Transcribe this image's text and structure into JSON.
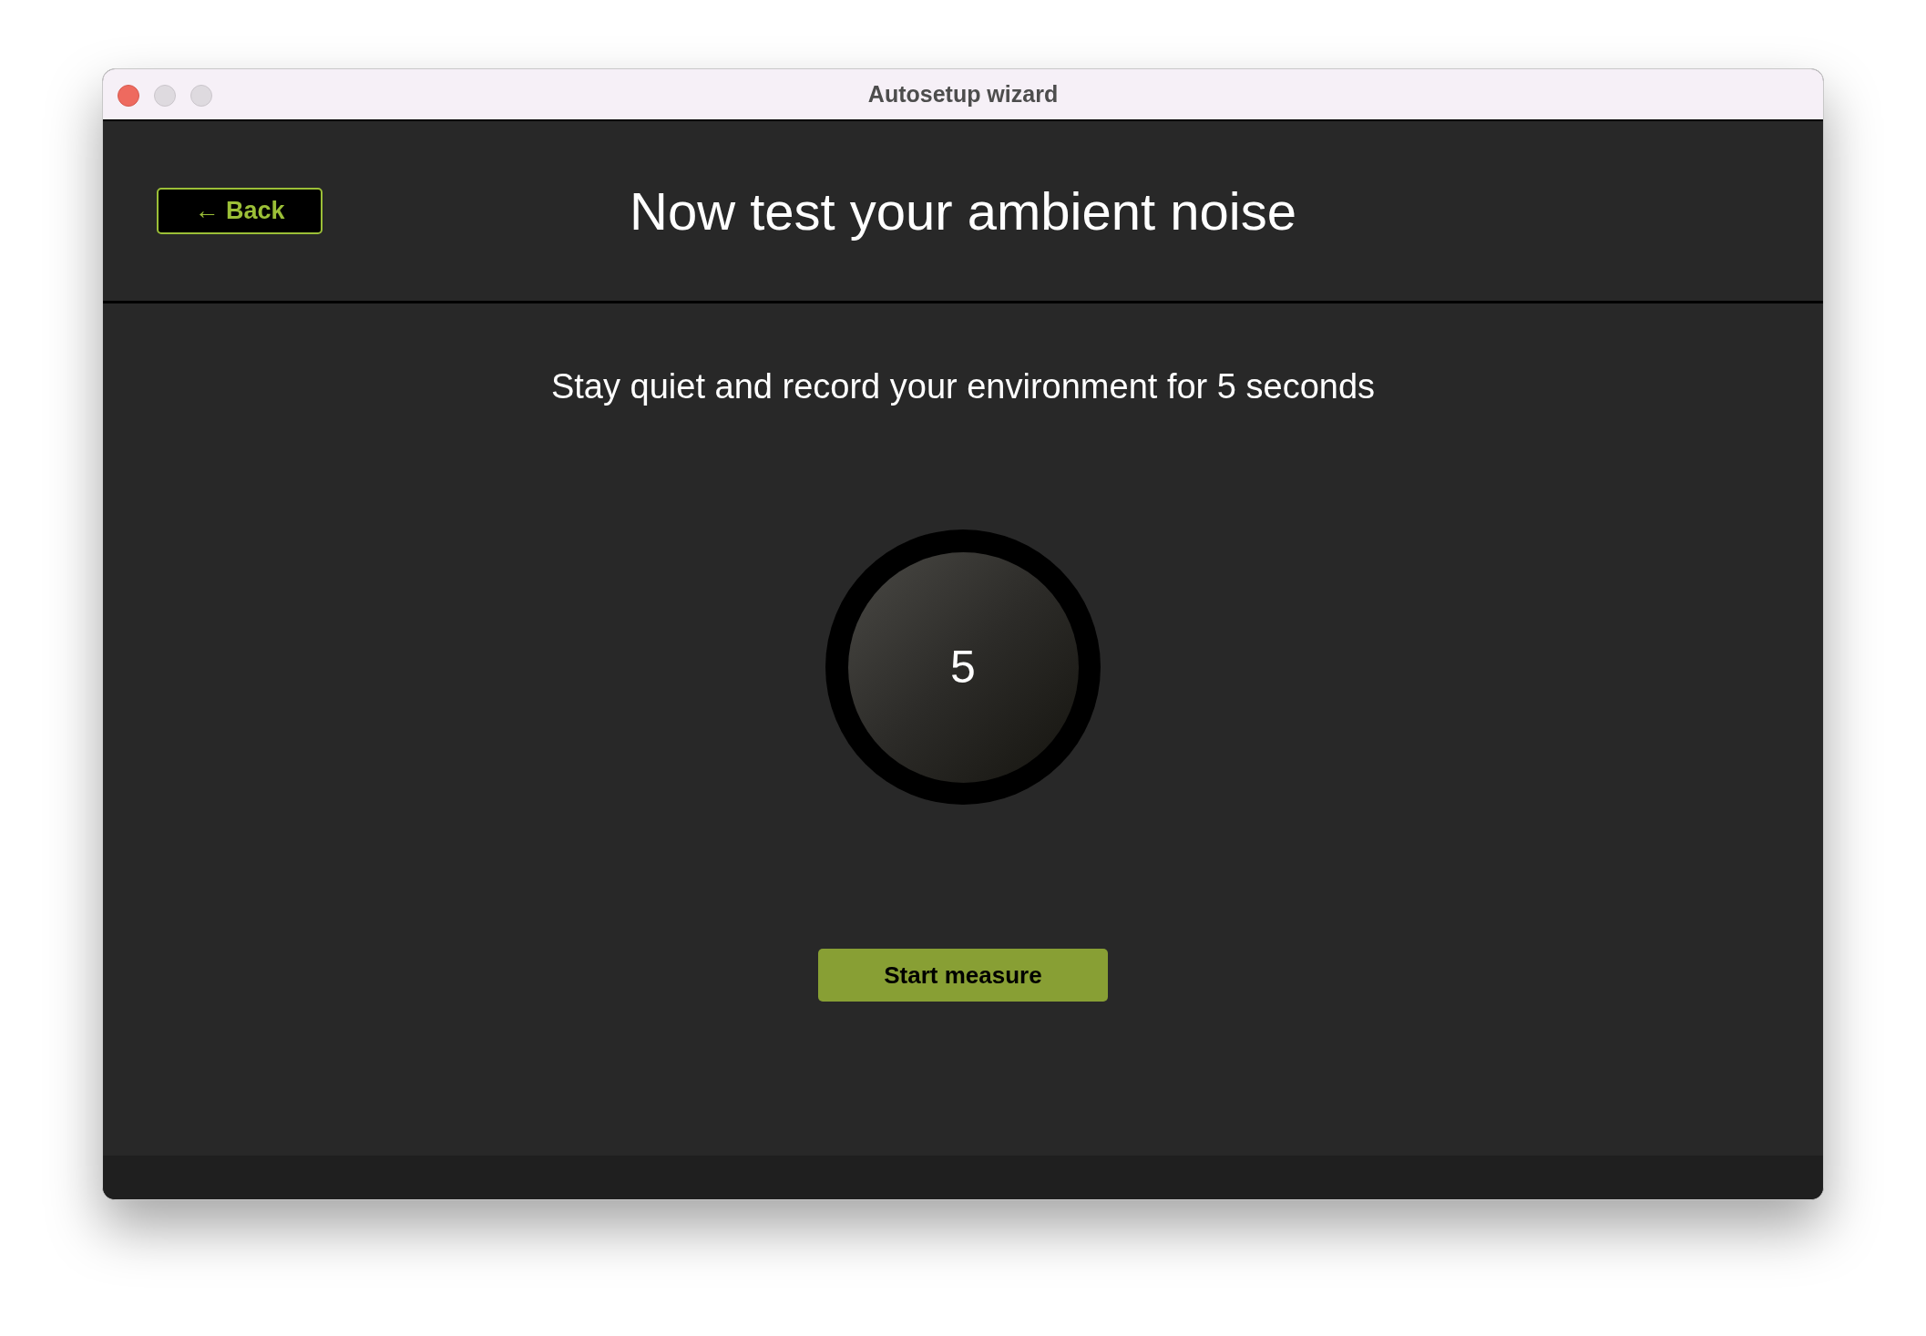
{
  "window": {
    "title": "Autosetup wizard"
  },
  "header": {
    "back_button": "← Back",
    "title": "Now test your ambient noise"
  },
  "instruction": "Stay quiet and record your environment for 5 seconds",
  "countdown": "5",
  "start_button": "Start measure"
}
